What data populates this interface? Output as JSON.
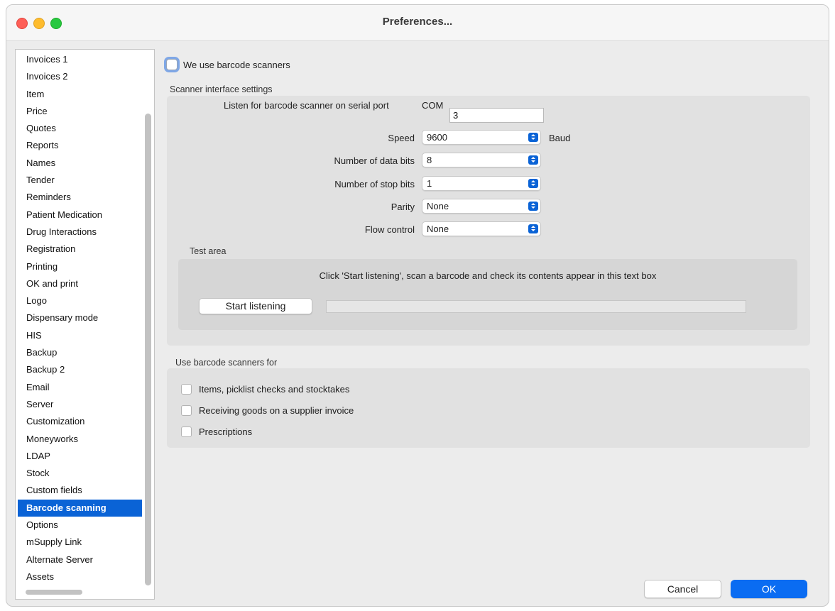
{
  "window": {
    "title": "Preferences..."
  },
  "sidebar": {
    "items": [
      "Invoices 1",
      "Invoices 2",
      "Item",
      "Price",
      "Quotes",
      "Reports",
      "Names",
      "Tender",
      "Reminders",
      "Patient Medication",
      "Drug Interactions",
      "Registration",
      "Printing",
      "OK and print",
      "Logo",
      "Dispensary mode",
      "HIS",
      "Backup",
      "Backup 2",
      "Email",
      "Server",
      "Customization",
      "Moneyworks",
      "LDAP",
      "Stock",
      "Custom fields",
      "Barcode scanning",
      "Options",
      "mSupply Link",
      "Alternate Server",
      "Assets"
    ],
    "selected": "Barcode scanning"
  },
  "master_checkbox": {
    "label": "We use barcode scanners",
    "checked": false
  },
  "scanner": {
    "group_label": "Scanner interface settings",
    "serial_port": {
      "label": "Listen for barcode scanner on serial port",
      "prefix": "COM",
      "value": "3"
    },
    "speed": {
      "label": "Speed",
      "value": "9600",
      "unit": "Baud"
    },
    "data_bits": {
      "label": "Number of data bits",
      "value": "8"
    },
    "stop_bits": {
      "label": "Number of stop bits",
      "value": "1"
    },
    "parity": {
      "label": "Parity",
      "value": "None"
    },
    "flow_control": {
      "label": "Flow control",
      "value": "None"
    }
  },
  "test_area": {
    "label": "Test area",
    "hint": "Click 'Start listening', scan a barcode and check its contents appear in this text box",
    "button": "Start listening"
  },
  "use_for": {
    "group_label": "Use barcode scanners for",
    "options": [
      {
        "label": "Items, picklist checks and stocktakes",
        "checked": false
      },
      {
        "label": "Receiving goods on a supplier invoice",
        "checked": false
      },
      {
        "label": "Prescriptions",
        "checked": false
      }
    ]
  },
  "footer": {
    "cancel": "Cancel",
    "ok": "OK"
  },
  "colors": {
    "accent": "#0a63d6",
    "ok_button": "#0a6cf2"
  }
}
